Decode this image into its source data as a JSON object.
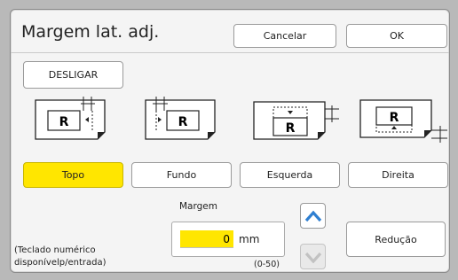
{
  "title": "Margem lat. adj.",
  "buttons": {
    "cancel": "Cancelar",
    "ok": "OK",
    "off": "DESLIGAR",
    "reduction": "Redução"
  },
  "options": [
    {
      "label": "Topo",
      "selected": true
    },
    {
      "label": "Fundo",
      "selected": false
    },
    {
      "label": "Esquerda",
      "selected": false
    },
    {
      "label": "Direita",
      "selected": false
    }
  ],
  "thumbnail_glyph": "R",
  "margin": {
    "label": "Margem",
    "value": "0",
    "unit": "mm",
    "range": "(0-50)"
  },
  "keypad_hint": {
    "line1": "(Teclado numérico",
    "line2": "disponívelp/entrada)"
  },
  "icons": {
    "up": "chevron-up-icon",
    "down": "chevron-down-icon"
  },
  "colors": {
    "selected": "#ffe600",
    "arrow": "#2f7fd1",
    "panel": "#f4f4f4",
    "background": "#b9b9b9"
  }
}
